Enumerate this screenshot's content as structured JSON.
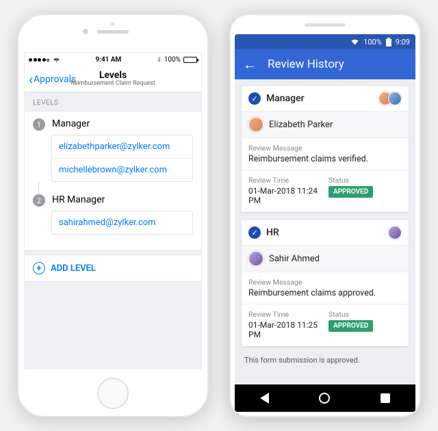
{
  "ios": {
    "status": {
      "time": "9:41 AM",
      "battery_pct": "100%"
    },
    "nav": {
      "back_label": "Approvals",
      "title": "Levels",
      "subtitle": "Reimbursement Claim Request"
    },
    "section_header": "LEVELS",
    "levels": [
      {
        "num": "1",
        "title": "Manager",
        "emails": [
          "elizabethparker@zylker.com",
          "michellebrown@zylker.com"
        ]
      },
      {
        "num": "2",
        "title": "HR Manager",
        "emails": [
          "sahirahmed@zylker.com"
        ]
      }
    ],
    "add_level_label": "ADD LEVEL"
  },
  "android": {
    "status": {
      "battery_pct": "100%",
      "time": "9:09"
    },
    "appbar": {
      "title": "Review History"
    },
    "reviews": [
      {
        "role": "Manager",
        "avatars": 2,
        "reviewer_name": "Elizabeth Parker",
        "message_label": "Review Message",
        "message": "Reimbursement claims verified.",
        "time_label": "Review Time",
        "time": "01-Mar-2018 11:24 PM",
        "status_label": "Status",
        "status": "APPROVED"
      },
      {
        "role": "HR",
        "avatars": 1,
        "reviewer_name": "Sahir Ahmed",
        "message_label": "Review Message",
        "message": "Reimbursement claims approved.",
        "time_label": "Review Time",
        "time": "01-Mar-2018 11:25 PM",
        "status_label": "Status",
        "status": "APPROVED"
      }
    ],
    "footer_note": "This form submission is approved."
  }
}
